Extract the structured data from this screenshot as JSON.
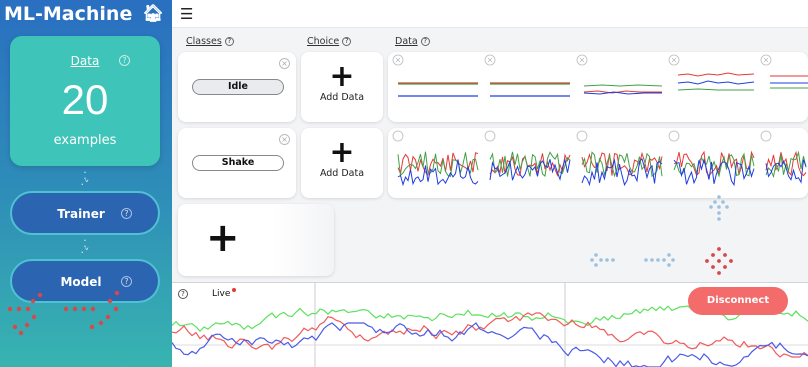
{
  "app": {
    "title": "ML-Machine"
  },
  "sidebar": {
    "data_card": {
      "label": "Data",
      "count": "20",
      "unit": "examples"
    },
    "steps": [
      {
        "label": "Trainer"
      },
      {
        "label": "Model"
      }
    ]
  },
  "headers": {
    "classes": "Classes",
    "choice": "Choice",
    "data": "Data"
  },
  "gestures": [
    {
      "name": "Idle",
      "add_label": "Add Data",
      "samples": 5
    },
    {
      "name": "Shake",
      "add_label": "Add Data",
      "samples": 5
    }
  ],
  "live": {
    "label": "Live",
    "button": "Disconnect"
  },
  "colors": {
    "accent": "#3ec4b8",
    "disconnect": "#f36b6b",
    "red": "#e53935",
    "green": "#43a047",
    "blue": "#1e3de0"
  },
  "icons": {
    "home": "home-icon",
    "menu": "hamburger-icon",
    "help": "help-icon",
    "close": "close-icon",
    "add": "plus-icon"
  }
}
